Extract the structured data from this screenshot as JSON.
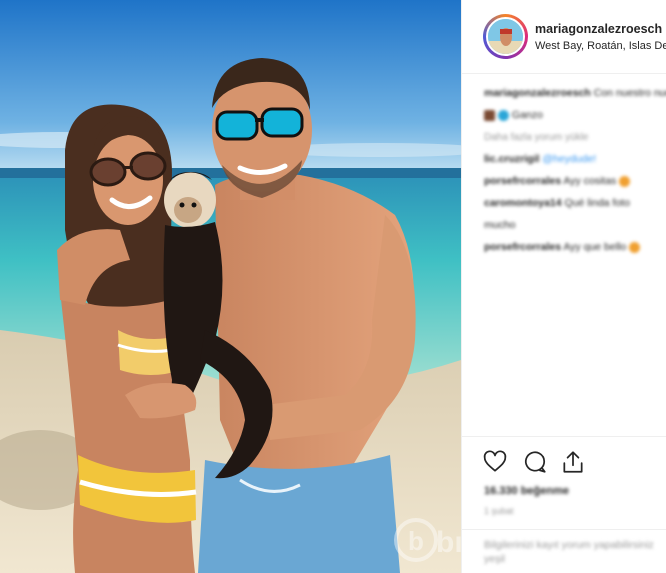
{
  "post": {
    "username": "mariagonzalezroesch",
    "location": "West Bay, Roatán, Islas De la Bahía"
  },
  "comments": [
    {
      "user": "mariagonzalezroesch",
      "text": "Con nuestro nuevo amigo"
    },
    {
      "user": "",
      "text": "Ganzo"
    },
    {
      "user": "",
      "text": "Daha fazla yorum yükle"
    },
    {
      "user": "lic.cruzrigil",
      "text": "@heydude!"
    },
    {
      "user": "porsefrcorrales",
      "text": "Ayy cositas"
    },
    {
      "user": "caromontoya14",
      "text": "Qué linda foto"
    },
    {
      "user": "",
      "text": "mucho"
    },
    {
      "user": "porsefrcorrales",
      "text": "Ayy que bello"
    }
  ],
  "actions": {
    "likes": "16.330 beğenme",
    "date": "1 şubat",
    "comment_placeholder": "Bilgilerinizi kayıt yorum yapabilirsiniz yeşil"
  },
  "icons": [
    "heart-icon",
    "comment-icon",
    "share-icon"
  ],
  "watermark": "bı",
  "colors": {
    "link": "#3897f0",
    "border": "#efefef",
    "muted": "#999999"
  }
}
